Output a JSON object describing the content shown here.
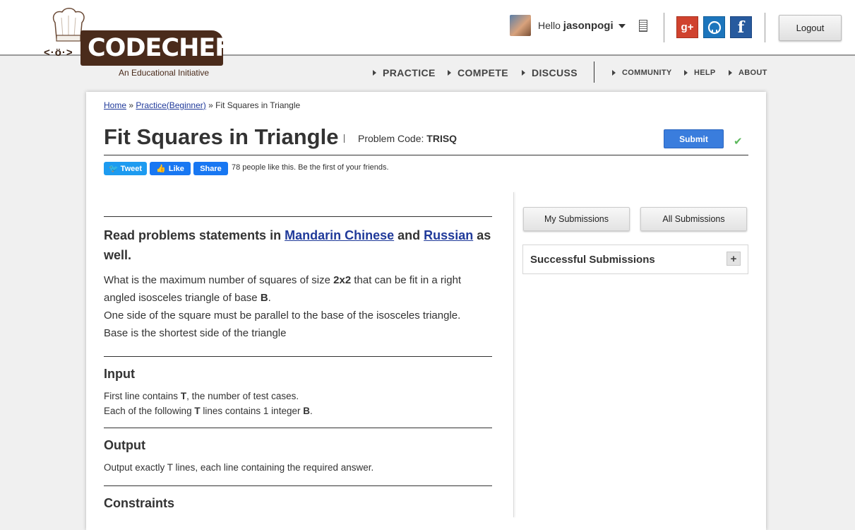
{
  "brand": {
    "name": "CODECHEF",
    "face": "<·ö·>",
    "tagline": "An Educational Initiative"
  },
  "user": {
    "greeting": "Hello",
    "username": "jasonpogi"
  },
  "social": {
    "gplus": "g+",
    "github": "◉",
    "facebook": "f"
  },
  "header": {
    "logout_label": "Logout"
  },
  "nav": {
    "main": [
      "PRACTICE",
      "COMPETE",
      "DISCUSS"
    ],
    "sub": [
      "COMMUNITY",
      "HELP",
      "ABOUT"
    ]
  },
  "breadcrumb": {
    "home": "Home",
    "sep1": "»",
    "practice": "Practice(Beginner)",
    "sep2": "»",
    "current": "Fit Squares in Triangle"
  },
  "problem": {
    "title": "Fit Squares in Triangle",
    "code_label": "Problem Code:",
    "code": "TRISQ",
    "submit_label": "Submit",
    "check": "✔"
  },
  "share": {
    "tweet": "Tweet",
    "like": "Like",
    "share": "Share",
    "likes_text": "78 people like this. Be the first of your friends."
  },
  "statement": {
    "read_prefix": "Read problems statements in",
    "lang1": "Mandarin Chinese",
    "and": "and",
    "lang2": "Russian",
    "read_suffix": "as well.",
    "p1_a": "What is the maximum number of squares of size",
    "p1_b": "2x2",
    "p1_c": "that can be fit in a right angled isosceles triangle of base",
    "p1_d": "B",
    "p1_e": ".",
    "p2": "One side of the square must be parallel to the base of the isosceles triangle.",
    "p3": "Base is the shortest side of the triangle"
  },
  "input": {
    "heading": "Input",
    "l1_a": "First line contains",
    "l1_b": "T",
    "l1_c": ", the number of test cases.",
    "l2_a": "Each of the following",
    "l2_b": "T",
    "l2_c": "lines contains 1 integer",
    "l2_d": "B",
    "l2_e": "."
  },
  "output": {
    "heading": "Output",
    "text": "Output exactly T lines, each line containing the required answer."
  },
  "constraints": {
    "heading": "Constraints"
  },
  "sidebar": {
    "my_submissions": "My Submissions",
    "all_submissions": "All Submissions",
    "successful": "Successful Submissions",
    "plus": "+"
  }
}
